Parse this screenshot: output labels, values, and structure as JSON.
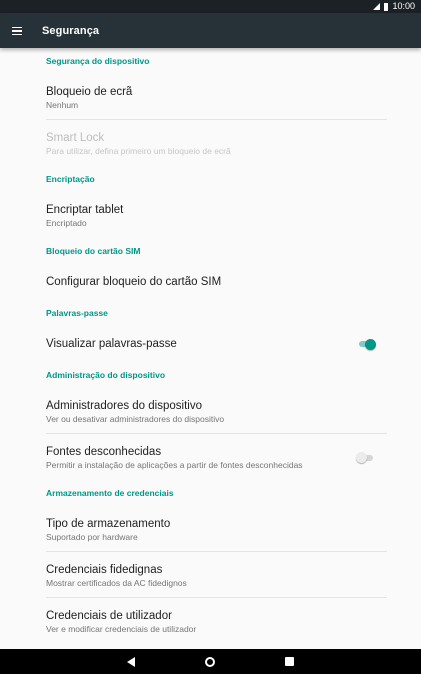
{
  "status_bar": {
    "time": "10:00"
  },
  "app_bar": {
    "title": "Segurança"
  },
  "sections": {
    "device_security": "Segurança do dispositivo",
    "encryption": "Encriptação",
    "sim_lock": "Bloqueio do cartão SIM",
    "passwords": "Palavras-passe",
    "device_admin": "Administração do dispositivo",
    "credential_storage": "Armazenamento de credenciais"
  },
  "items": {
    "screen_lock": {
      "title": "Bloqueio de ecrã",
      "subtitle": "Nenhum"
    },
    "smart_lock": {
      "title": "Smart Lock",
      "subtitle": "Para utilizar, defina primeiro um bloqueio de ecrã"
    },
    "encrypt_tablet": {
      "title": "Encriptar tablet",
      "subtitle": "Encriptado"
    },
    "sim_lock": {
      "title": "Configurar bloqueio do cartão SIM"
    },
    "show_passwords": {
      "title": "Visualizar palavras-passe",
      "checked": true
    },
    "device_admins": {
      "title": "Administradores do dispositivo",
      "subtitle": "Ver ou desativar administradores do dispositivo"
    },
    "unknown_sources": {
      "title": "Fontes desconhecidas",
      "subtitle": "Permitir a instalação de aplicações a partir de fontes desconhecidas",
      "checked": false
    },
    "storage_type": {
      "title": "Tipo de armazenamento",
      "subtitle": "Suportado por hardware"
    },
    "trusted_credentials": {
      "title": "Credenciais fidedignas",
      "subtitle": "Mostrar certificados da AC fidedignos"
    },
    "user_credentials": {
      "title": "Credenciais de utilizador",
      "subtitle": "Ver e modificar credenciais de utilizador"
    }
  },
  "colors": {
    "accent": "#009688",
    "app_bar": "#263238",
    "background": "#fafafa"
  }
}
